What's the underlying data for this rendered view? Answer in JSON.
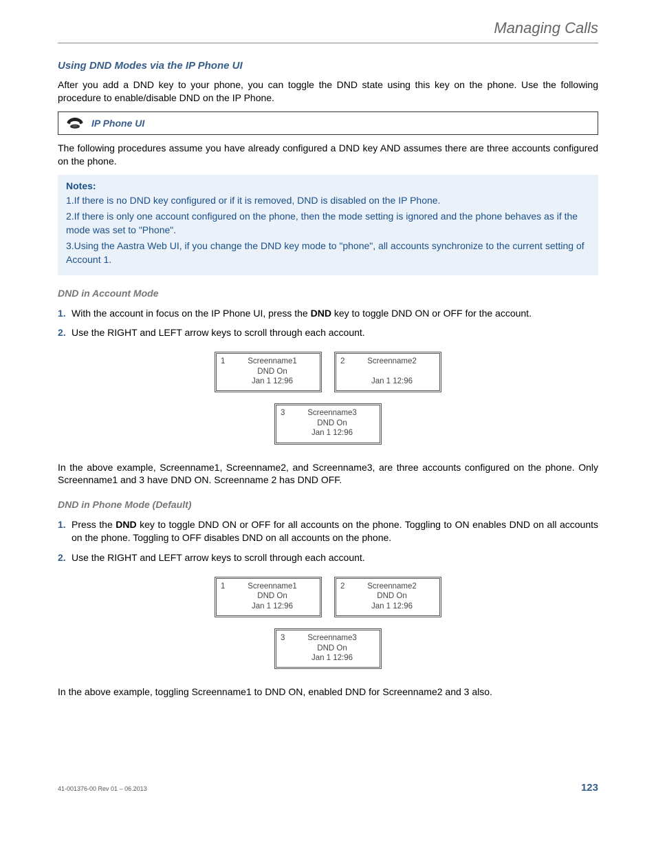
{
  "header": {
    "title": "Managing Calls"
  },
  "section1": {
    "heading": "Using DND Modes via the IP Phone UI",
    "intro": "After you add a DND key to your phone, you can toggle the DND state using this key on the phone. Use the following procedure to enable/disable DND on the IP Phone.",
    "uibox_label": "IP Phone UI",
    "assume": "The following procedures assume you have already configured a DND key AND assumes there are three accounts configured on the phone."
  },
  "notes": {
    "heading": "Notes:",
    "items": [
      "1.If there is no DND key configured or if it is removed, DND is disabled on the IP Phone.",
      "2.If there is only one account configured on the phone, then the mode setting is ignored and the phone behaves as if the mode was set to \"Phone\".",
      "3.Using the Aastra Web UI, if you change the DND key mode to \"phone\", all accounts synchronize to the current setting of Account 1."
    ]
  },
  "account_mode": {
    "heading": "DND in Account Mode",
    "steps": [
      {
        "n": "1.",
        "pre": "With the account in focus on the IP Phone UI, press the ",
        "bold": "DND",
        "post": " key to toggle DND ON or OFF for the account."
      },
      {
        "n": "2.",
        "pre": "Use the RIGHT and LEFT arrow keys to scroll through each account.",
        "bold": "",
        "post": ""
      }
    ],
    "screens": [
      {
        "idx": "1",
        "name": "Screenname1",
        "dnd": "DND On",
        "time": "Jan 1 12:96"
      },
      {
        "idx": "2",
        "name": "Screenname2",
        "dnd": "",
        "time": "Jan 1 12:96"
      },
      {
        "idx": "3",
        "name": "Screenname3",
        "dnd": "DND On",
        "time": "Jan 1 12:96"
      }
    ],
    "caption": "In the above example, Screenname1, Screenname2, and Screenname3, are three accounts configured on the phone. Only Screenname1 and 3 have DND ON. Screenname 2 has DND OFF."
  },
  "phone_mode": {
    "heading": "DND in Phone Mode (Default)",
    "steps": [
      {
        "n": "1.",
        "pre": "Press the ",
        "bold": "DND",
        "post": " key to toggle DND ON or OFF for all accounts on the phone. Toggling to ON enables DND on all accounts on the phone. Toggling to OFF disables DND on all accounts on the phone."
      },
      {
        "n": "2.",
        "pre": "Use the RIGHT and LEFT arrow keys to scroll through each account.",
        "bold": "",
        "post": ""
      }
    ],
    "screens": [
      {
        "idx": "1",
        "name": "Screenname1",
        "dnd": "DND On",
        "time": "Jan 1 12:96"
      },
      {
        "idx": "2",
        "name": "Screenname2",
        "dnd": "DND On",
        "time": "Jan 1 12:96"
      },
      {
        "idx": "3",
        "name": "Screenname3",
        "dnd": "DND On",
        "time": "Jan 1 12:96"
      }
    ],
    "caption": "In the above example, toggling Screenname1 to DND ON, enabled DND for Screenname2 and 3 also."
  },
  "footer": {
    "left": "41-001376-00 Rev 01 – 06.2013",
    "right": "123"
  }
}
